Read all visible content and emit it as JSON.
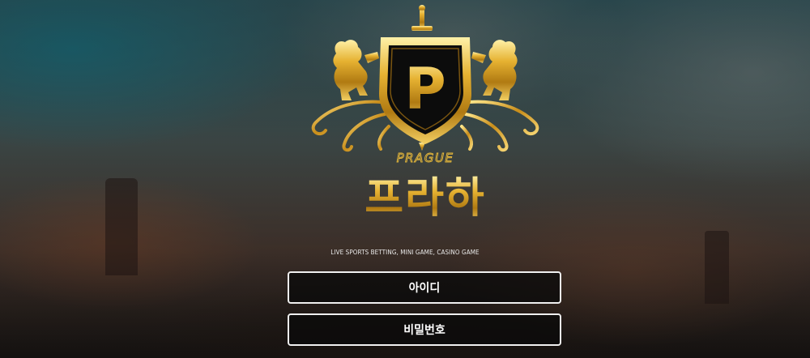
{
  "brand": {
    "logo_letter": "P",
    "logo_subtitle": "PRAGUE",
    "name_korean": "프라하"
  },
  "tagline": "LIVE SPORTS BETTING, MINI GAME, CASINO GAME",
  "login": {
    "id_placeholder": "아이디",
    "password_placeholder": "비밀번호"
  },
  "colors": {
    "gold": "#d9a520",
    "field_border": "#f0f0f0",
    "field_bg": "#0a0a0a"
  }
}
